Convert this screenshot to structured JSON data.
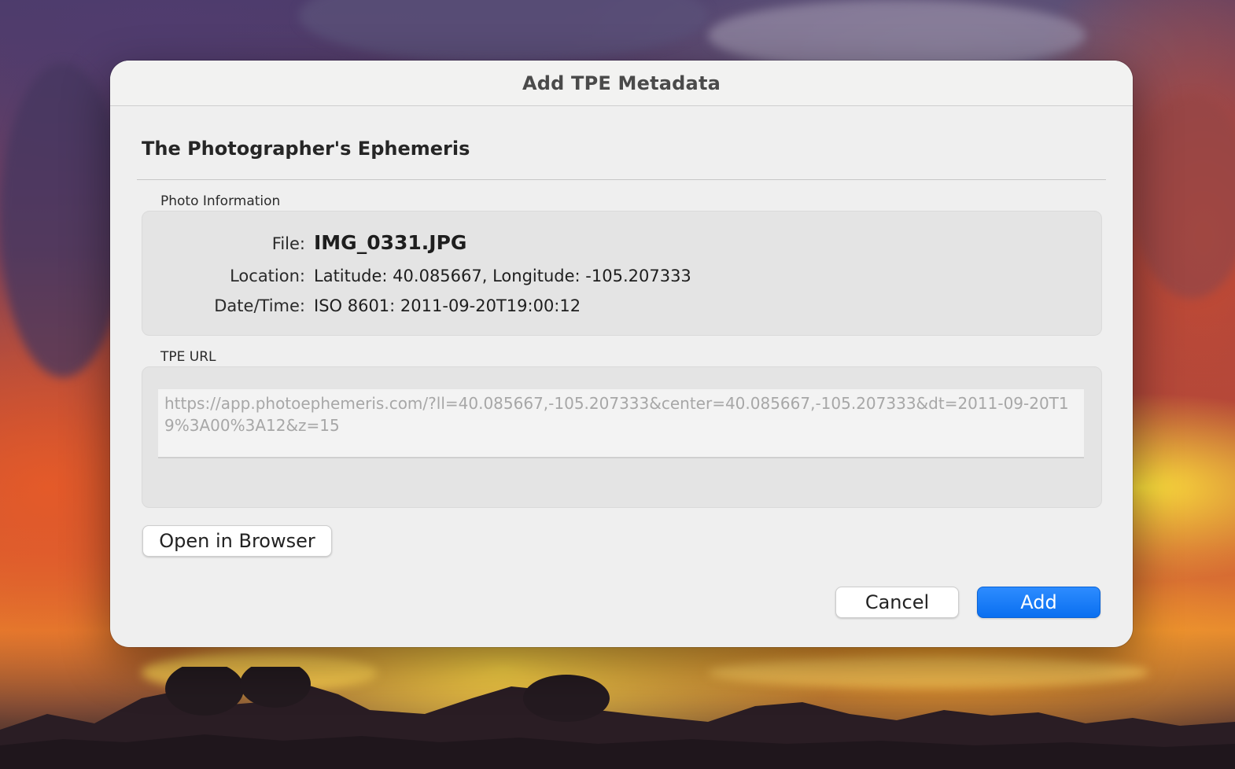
{
  "dialog": {
    "title": "Add TPE Metadata",
    "heading": "The Photographer's Ephemeris"
  },
  "photo_info": {
    "group_label": "Photo Information",
    "rows": [
      {
        "label": "File:",
        "value": "IMG_0331.JPG"
      },
      {
        "label": "Location:",
        "value": "Latitude: 40.085667, Longitude: -105.207333"
      },
      {
        "label": "Date/Time:",
        "value": "ISO 8601: 2011-09-20T19:00:12"
      }
    ]
  },
  "tpe_url": {
    "group_label": "TPE URL",
    "value": "https://app.photoephemeris.com/?ll=40.085667,-105.207333&center=40.085667,-105.207333&dt=2011-09-20T19%3A00%3A12&z=15"
  },
  "buttons": {
    "open_browser": "Open in Browser",
    "cancel": "Cancel",
    "add": "Add"
  },
  "colors": {
    "accent": "#0a6ff0",
    "dialog_bg": "#efefef"
  }
}
